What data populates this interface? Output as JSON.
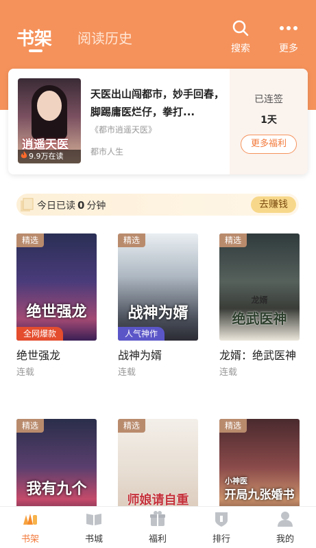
{
  "header": {
    "tab_shelf": "书架",
    "tab_history": "阅读历史",
    "search_label": "搜索",
    "more_label": "更多",
    "bg_color": "#f5925b"
  },
  "recommend": {
    "cover_title": "逍遥天医",
    "readers": "9.9万在读",
    "title": "天医出山闯都市，妙手回春，脚踢庸医烂仔，拳打...",
    "book_name": "《都市逍遥天医》",
    "category": "都市人生",
    "signed_label": "已连签",
    "signed_days": "1天",
    "welfare_button": "更多福利"
  },
  "reading": {
    "prefix": "今日已读",
    "minutes": "0",
    "suffix": "分钟",
    "earn_button": "去赚钱"
  },
  "books": [
    {
      "tag": "精选",
      "cover_text": "绝世强龙",
      "ribbon": "全网爆款",
      "title": "绝世强龙",
      "status": "连载"
    },
    {
      "tag": "精选",
      "cover_text": "战神为婿",
      "ribbon": "人气神作",
      "title": "战神为婿",
      "status": "连载"
    },
    {
      "tag": "精选",
      "cover_text": "绝武医神",
      "cover_sub": "龙婿",
      "title": "龙婿：绝武医神",
      "status": "连载"
    },
    {
      "tag": "精选",
      "cover_text": "我有九个"
    },
    {
      "tag": "精选",
      "cover_text": "师娘请自重"
    },
    {
      "tag": "精选",
      "cover_text": "开局九张婚书",
      "cover_sub": "小神医"
    }
  ],
  "nav": {
    "shelf": "书架",
    "store": "书城",
    "welfare": "福利",
    "rank": "排行",
    "mine": "我的",
    "active_color": "#f27a3c"
  }
}
